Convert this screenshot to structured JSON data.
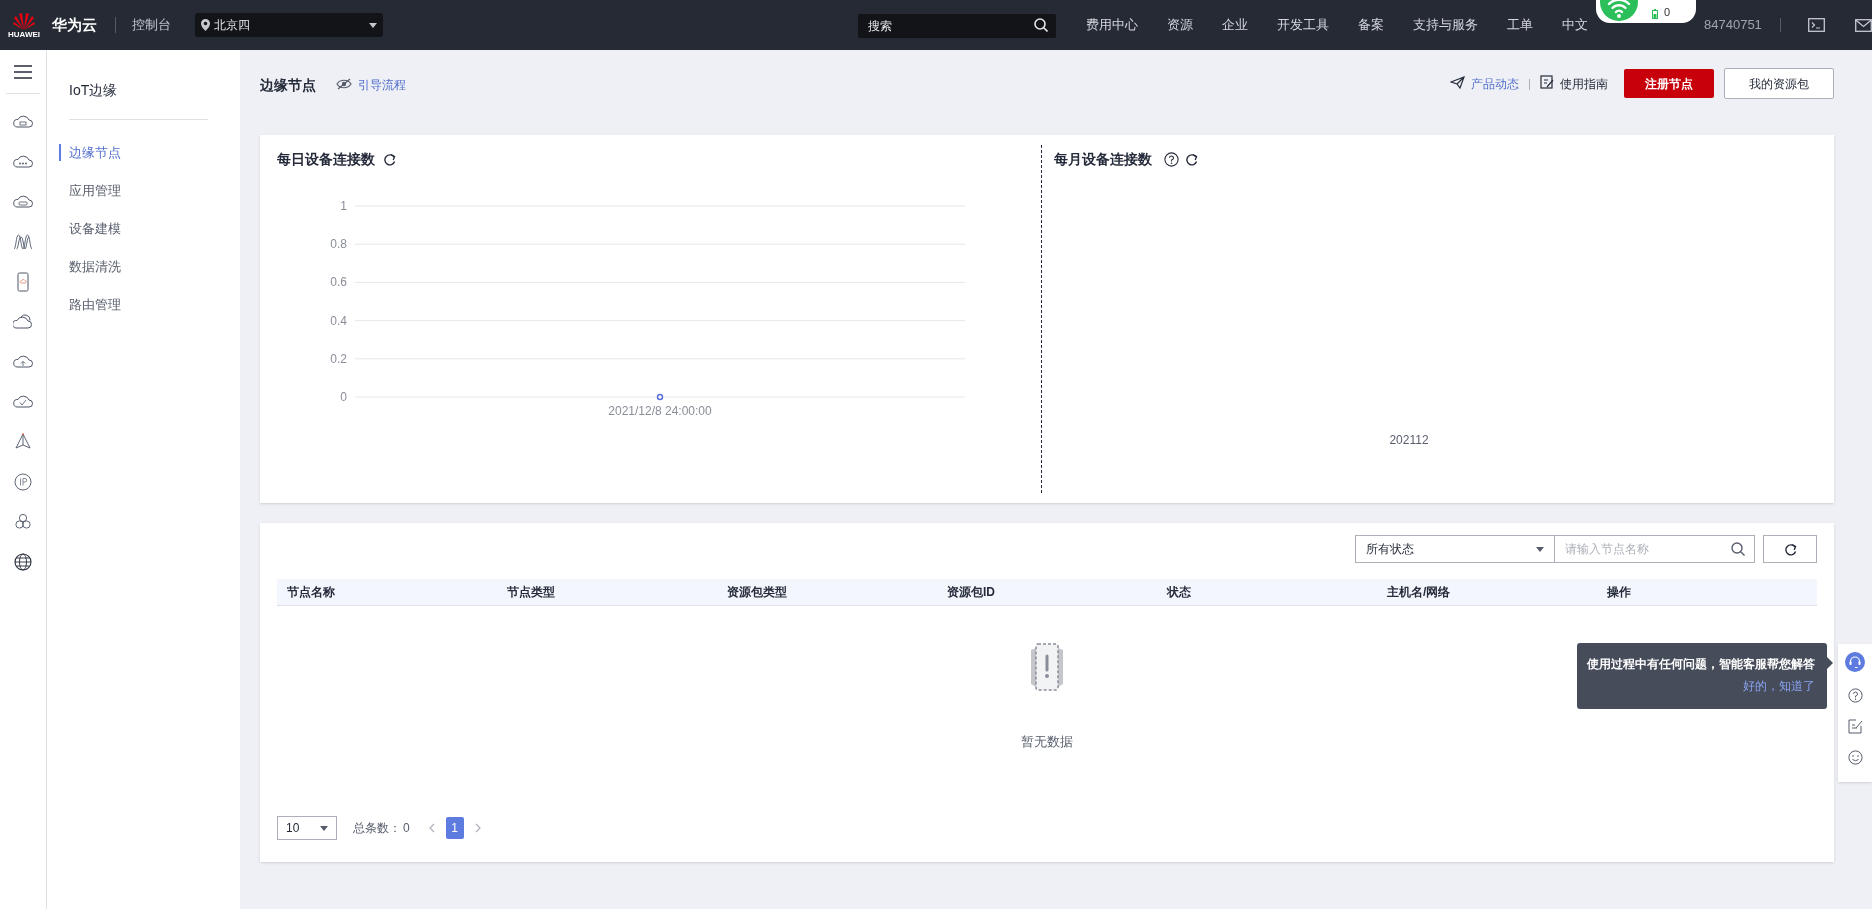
{
  "topbar": {
    "logo_text": "HUAWEI",
    "brand": "华为云",
    "console": "控制台",
    "region": "北京四",
    "search_placeholder": "搜索",
    "menu": [
      "费用中心",
      "资源",
      "企业",
      "开发工具",
      "备案",
      "支持与服务",
      "工单",
      "中文"
    ],
    "account": "84740751"
  },
  "status_popup": {
    "count": "0"
  },
  "nav": {
    "title": "IoT边缘",
    "items": [
      {
        "label": "边缘节点",
        "selected": true
      },
      {
        "label": "应用管理",
        "selected": false
      },
      {
        "label": "设备建模",
        "selected": false
      },
      {
        "label": "数据清洗",
        "selected": false
      },
      {
        "label": "路由管理",
        "selected": false
      }
    ]
  },
  "page": {
    "title": "边缘节点",
    "guide_link": "引导流程",
    "product_news": "产品动态",
    "user_guide": "使用指南",
    "primary_button": "注册节点",
    "secondary_button": "我的资源包"
  },
  "daily_chart": {
    "title": "每日设备连接数",
    "chart_data": {
      "type": "line",
      "x": [
        "2021/12/8 24:00:00"
      ],
      "series": [
        {
          "color": "#5b6fd6",
          "marker": true,
          "values": [
            0
          ]
        }
      ],
      "grid": true,
      "ylim": [
        0,
        1
      ],
      "yticks": [
        0,
        0.2,
        0.4,
        0.6,
        0.8,
        1
      ]
    }
  },
  "monthly_chart": {
    "title": "每月设备连接数",
    "x_label": "202112"
  },
  "table": {
    "status_filter": "所有状态",
    "search_placeholder": "请输入节点名称",
    "columns": [
      "节点名称",
      "节点类型",
      "资源包类型",
      "资源包ID",
      "状态",
      "主机名/网络",
      "操作"
    ],
    "empty_text": "暂无数据"
  },
  "pagination": {
    "page_size": "10",
    "total_label": "总条数：",
    "total": "0",
    "pages": [
      {
        "label": "1",
        "selected": true
      }
    ]
  },
  "tooltip": {
    "text": "使用过程中有任何问题，智能客服帮您解答",
    "action": "好的，知道了"
  }
}
